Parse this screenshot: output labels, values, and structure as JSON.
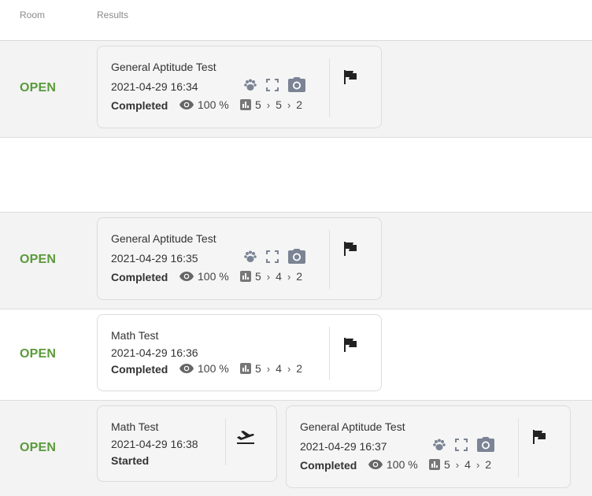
{
  "header": {
    "room_label": "Room",
    "results_label": "Results"
  },
  "rows": [
    {
      "status": "OPEN",
      "cards": [
        {
          "title": "General Aptitude Test",
          "datetime": "2021-04-29 16:34",
          "state": "Completed",
          "percent": "100 %",
          "score": [
            "5",
            "5",
            "2"
          ]
        }
      ]
    },
    {
      "status": "OPEN",
      "cards": [
        {
          "title": "General Aptitude Test",
          "datetime": "2021-04-29 16:35",
          "state": "Completed",
          "percent": "100 %",
          "score": [
            "5",
            "4",
            "2"
          ]
        }
      ]
    },
    {
      "status": "OPEN",
      "cards": [
        {
          "title": "Math Test",
          "datetime": "2021-04-29 16:36",
          "state": "Completed",
          "percent": "100 %",
          "score": [
            "5",
            "4",
            "2"
          ]
        }
      ]
    },
    {
      "status": "OPEN",
      "cards": [
        {
          "title": "Math Test",
          "datetime": "2021-04-29 16:38",
          "state": "Started"
        },
        {
          "title": "General Aptitude Test",
          "datetime": "2021-04-29 16:37",
          "state": "Completed",
          "percent": "100 %",
          "score": [
            "5",
            "4",
            "2"
          ]
        }
      ]
    }
  ],
  "symbols": {
    "chevron": "›"
  },
  "colors": {
    "open_status": "#5a9a3a",
    "icon_gray": "#7b8494",
    "row_shade": "#f3f3f3"
  }
}
